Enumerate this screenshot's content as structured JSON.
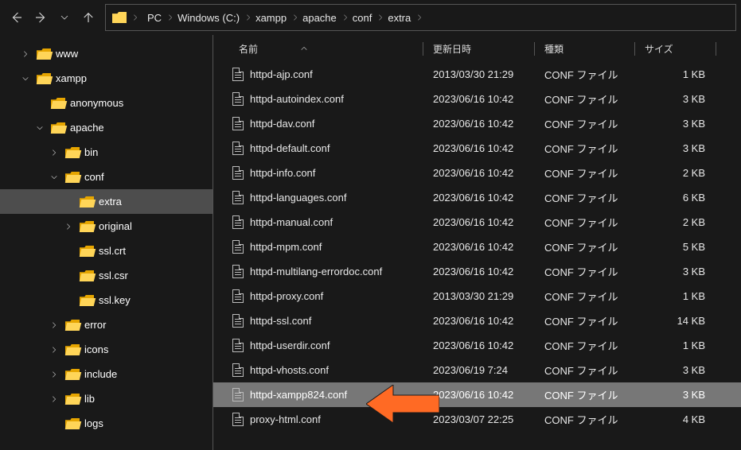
{
  "breadcrumbs": [
    "PC",
    "Windows (C:)",
    "xampp",
    "apache",
    "conf",
    "extra"
  ],
  "tree": [
    {
      "label": "www",
      "depth": 1,
      "twisty": "right",
      "selected": false
    },
    {
      "label": "xampp",
      "depth": 1,
      "twisty": "down",
      "selected": false
    },
    {
      "label": "anonymous",
      "depth": 2,
      "twisty": "blank",
      "selected": false
    },
    {
      "label": "apache",
      "depth": 2,
      "twisty": "down",
      "selected": false
    },
    {
      "label": "bin",
      "depth": 3,
      "twisty": "right",
      "selected": false
    },
    {
      "label": "conf",
      "depth": 3,
      "twisty": "down",
      "selected": false
    },
    {
      "label": "extra",
      "depth": 4,
      "twisty": "blank",
      "selected": true
    },
    {
      "label": "original",
      "depth": 4,
      "twisty": "right",
      "selected": false
    },
    {
      "label": "ssl.crt",
      "depth": 4,
      "twisty": "blank",
      "selected": false
    },
    {
      "label": "ssl.csr",
      "depth": 4,
      "twisty": "blank",
      "selected": false
    },
    {
      "label": "ssl.key",
      "depth": 4,
      "twisty": "blank",
      "selected": false
    },
    {
      "label": "error",
      "depth": 3,
      "twisty": "right",
      "selected": false
    },
    {
      "label": "icons",
      "depth": 3,
      "twisty": "right",
      "selected": false
    },
    {
      "label": "include",
      "depth": 3,
      "twisty": "right",
      "selected": false
    },
    {
      "label": "lib",
      "depth": 3,
      "twisty": "right",
      "selected": false
    },
    {
      "label": "logs",
      "depth": 3,
      "twisty": "blank",
      "selected": false
    }
  ],
  "columns": {
    "name": "名前",
    "date": "更新日時",
    "type": "種類",
    "size": "サイズ"
  },
  "files": [
    {
      "name": "httpd-ajp.conf",
      "date": "2013/03/30 21:29",
      "type": "CONF ファイル",
      "size": "1 KB",
      "selected": false
    },
    {
      "name": "httpd-autoindex.conf",
      "date": "2023/06/16 10:42",
      "type": "CONF ファイル",
      "size": "3 KB",
      "selected": false
    },
    {
      "name": "httpd-dav.conf",
      "date": "2023/06/16 10:42",
      "type": "CONF ファイル",
      "size": "3 KB",
      "selected": false
    },
    {
      "name": "httpd-default.conf",
      "date": "2023/06/16 10:42",
      "type": "CONF ファイル",
      "size": "3 KB",
      "selected": false
    },
    {
      "name": "httpd-info.conf",
      "date": "2023/06/16 10:42",
      "type": "CONF ファイル",
      "size": "2 KB",
      "selected": false
    },
    {
      "name": "httpd-languages.conf",
      "date": "2023/06/16 10:42",
      "type": "CONF ファイル",
      "size": "6 KB",
      "selected": false
    },
    {
      "name": "httpd-manual.conf",
      "date": "2023/06/16 10:42",
      "type": "CONF ファイル",
      "size": "2 KB",
      "selected": false
    },
    {
      "name": "httpd-mpm.conf",
      "date": "2023/06/16 10:42",
      "type": "CONF ファイル",
      "size": "5 KB",
      "selected": false
    },
    {
      "name": "httpd-multilang-errordoc.conf",
      "date": "2023/06/16 10:42",
      "type": "CONF ファイル",
      "size": "3 KB",
      "selected": false
    },
    {
      "name": "httpd-proxy.conf",
      "date": "2013/03/30 21:29",
      "type": "CONF ファイル",
      "size": "1 KB",
      "selected": false
    },
    {
      "name": "httpd-ssl.conf",
      "date": "2023/06/16 10:42",
      "type": "CONF ファイル",
      "size": "14 KB",
      "selected": false
    },
    {
      "name": "httpd-userdir.conf",
      "date": "2023/06/16 10:42",
      "type": "CONF ファイル",
      "size": "1 KB",
      "selected": false
    },
    {
      "name": "httpd-vhosts.conf",
      "date": "2023/06/19 7:24",
      "type": "CONF ファイル",
      "size": "3 KB",
      "selected": false
    },
    {
      "name": "httpd-xampp824.conf",
      "date": "2023/06/16 10:42",
      "type": "CONF ファイル",
      "size": "3 KB",
      "selected": true
    },
    {
      "name": "proxy-html.conf",
      "date": "2023/03/07 22:25",
      "type": "CONF ファイル",
      "size": "4 KB",
      "selected": false
    }
  ]
}
